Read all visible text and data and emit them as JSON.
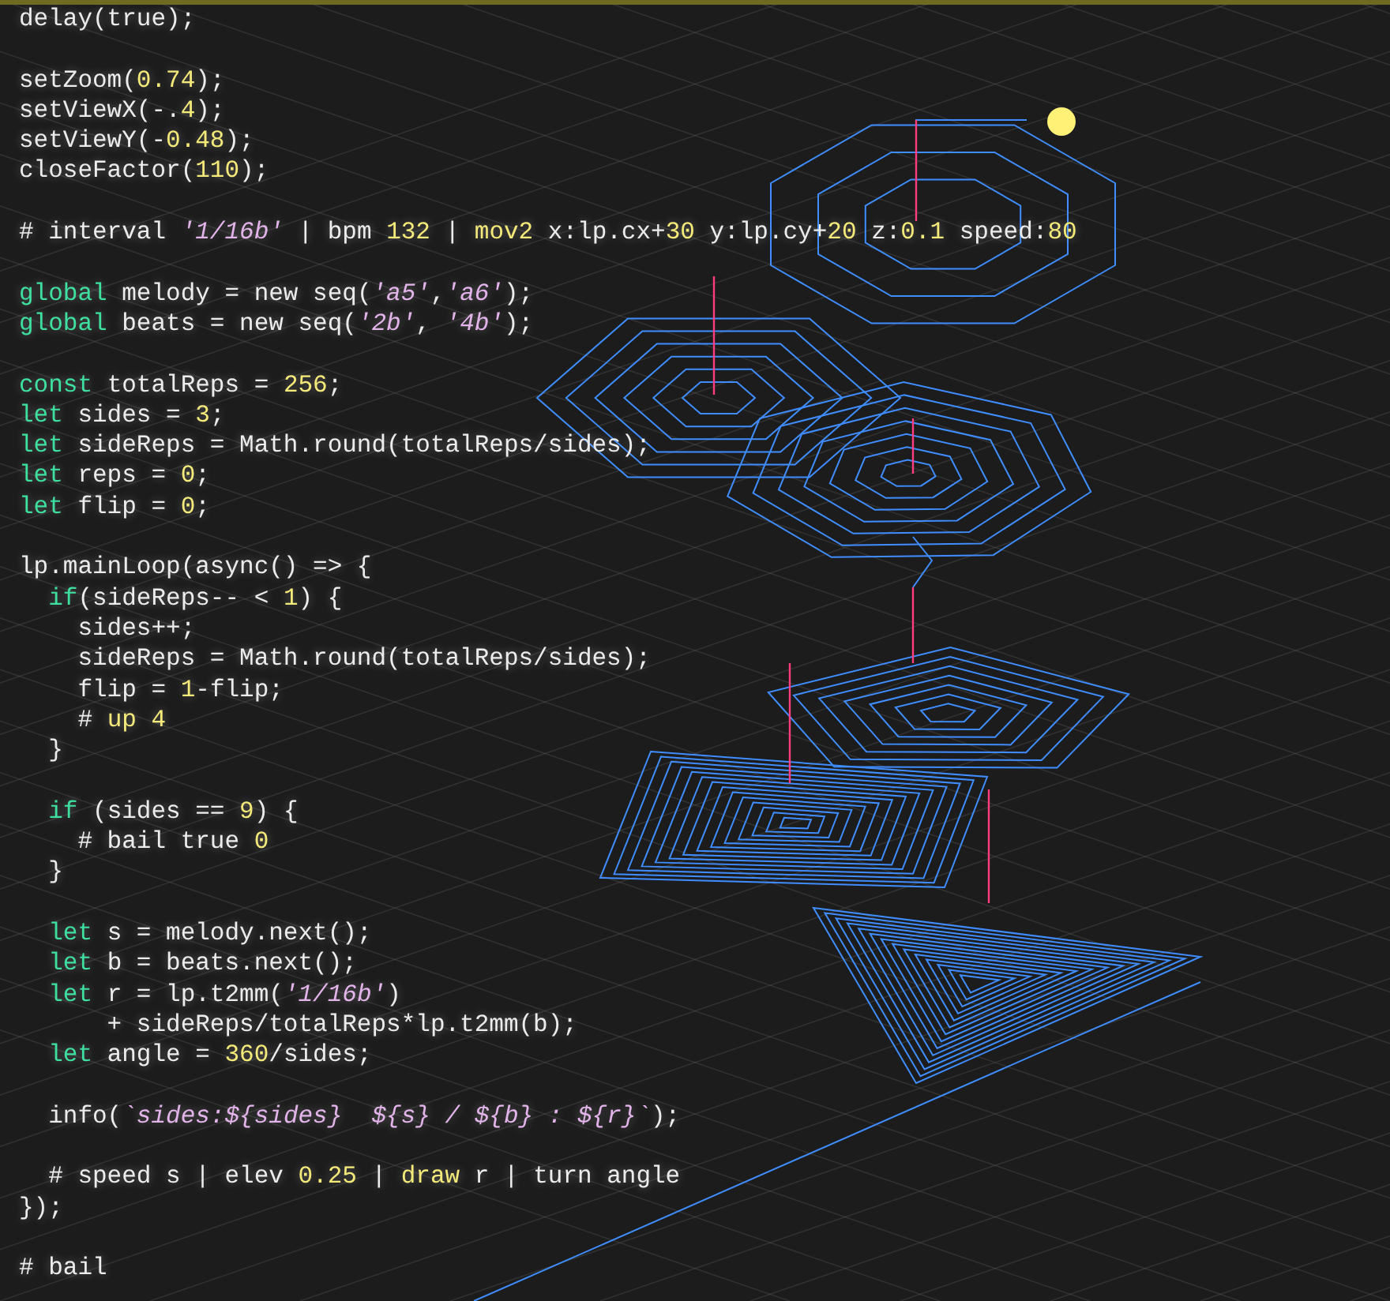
{
  "editor": {
    "lines": [
      {
        "kind": "code",
        "tokens": [
          {
            "kind": "plain",
            "text": "delay(true);"
          }
        ]
      },
      {
        "kind": "blank"
      },
      {
        "kind": "code",
        "tokens": [
          {
            "kind": "plain",
            "text": "setZoom("
          },
          {
            "kind": "number",
            "text": "0.74"
          },
          {
            "kind": "plain",
            "text": ");"
          }
        ]
      },
      {
        "kind": "code",
        "tokens": [
          {
            "kind": "plain",
            "text": "setViewX(-."
          },
          {
            "kind": "number",
            "text": "4"
          },
          {
            "kind": "plain",
            "text": ");"
          }
        ]
      },
      {
        "kind": "code",
        "tokens": [
          {
            "kind": "plain",
            "text": "setViewY(-"
          },
          {
            "kind": "number",
            "text": "0.48"
          },
          {
            "kind": "plain",
            "text": ");"
          }
        ]
      },
      {
        "kind": "code",
        "tokens": [
          {
            "kind": "plain",
            "text": "closeFactor("
          },
          {
            "kind": "number",
            "text": "110"
          },
          {
            "kind": "plain",
            "text": ");"
          }
        ]
      },
      {
        "kind": "blank"
      },
      {
        "kind": "code",
        "tokens": [
          {
            "kind": "plain",
            "text": "# interval "
          },
          {
            "kind": "string",
            "text": "'1/16b'"
          },
          {
            "kind": "plain",
            "text": " | bpm "
          },
          {
            "kind": "number",
            "text": "132"
          },
          {
            "kind": "plain",
            "text": " | "
          },
          {
            "kind": "command",
            "text": "mov2"
          },
          {
            "kind": "plain",
            "text": " x:lp.cx+"
          },
          {
            "kind": "number",
            "text": "30"
          },
          {
            "kind": "plain",
            "text": " y:lp.cy+"
          },
          {
            "kind": "number",
            "text": "20"
          },
          {
            "kind": "plain",
            "text": " z:"
          },
          {
            "kind": "number",
            "text": "0.1"
          },
          {
            "kind": "plain",
            "text": " speed:"
          },
          {
            "kind": "number",
            "text": "80"
          }
        ]
      },
      {
        "kind": "blank"
      },
      {
        "kind": "code",
        "tokens": [
          {
            "kind": "keyword",
            "text": "global"
          },
          {
            "kind": "plain",
            "text": " melody = new seq("
          },
          {
            "kind": "string",
            "text": "'a5'"
          },
          {
            "kind": "plain",
            "text": ","
          },
          {
            "kind": "string",
            "text": "'a6'"
          },
          {
            "kind": "plain",
            "text": ");"
          }
        ]
      },
      {
        "kind": "code",
        "tokens": [
          {
            "kind": "keyword",
            "text": "global"
          },
          {
            "kind": "plain",
            "text": " beats = new seq("
          },
          {
            "kind": "string",
            "text": "'2b'"
          },
          {
            "kind": "plain",
            "text": ", "
          },
          {
            "kind": "string",
            "text": "'4b'"
          },
          {
            "kind": "plain",
            "text": ");"
          }
        ]
      },
      {
        "kind": "blank"
      },
      {
        "kind": "code",
        "tokens": [
          {
            "kind": "keyword",
            "text": "const"
          },
          {
            "kind": "plain",
            "text": " totalReps = "
          },
          {
            "kind": "number",
            "text": "256"
          },
          {
            "kind": "plain",
            "text": ";"
          }
        ]
      },
      {
        "kind": "code",
        "tokens": [
          {
            "kind": "keyword",
            "text": "let"
          },
          {
            "kind": "plain",
            "text": " sides = "
          },
          {
            "kind": "number",
            "text": "3"
          },
          {
            "kind": "plain",
            "text": ";"
          }
        ]
      },
      {
        "kind": "code",
        "tokens": [
          {
            "kind": "keyword",
            "text": "let"
          },
          {
            "kind": "plain",
            "text": " sideReps = Math.round(totalReps/sides);"
          }
        ]
      },
      {
        "kind": "code",
        "tokens": [
          {
            "kind": "keyword",
            "text": "let"
          },
          {
            "kind": "plain",
            "text": " reps = "
          },
          {
            "kind": "number",
            "text": "0"
          },
          {
            "kind": "plain",
            "text": ";"
          }
        ]
      },
      {
        "kind": "code",
        "tokens": [
          {
            "kind": "keyword",
            "text": "let"
          },
          {
            "kind": "plain",
            "text": " flip = "
          },
          {
            "kind": "number",
            "text": "0"
          },
          {
            "kind": "plain",
            "text": ";"
          }
        ]
      },
      {
        "kind": "blank"
      },
      {
        "kind": "code",
        "tokens": [
          {
            "kind": "plain",
            "text": "lp.mainLoop(async() => {"
          }
        ]
      },
      {
        "kind": "code",
        "tokens": [
          {
            "kind": "keyword",
            "text": "  if"
          },
          {
            "kind": "plain",
            "text": "(sideReps-- < "
          },
          {
            "kind": "number",
            "text": "1"
          },
          {
            "kind": "plain",
            "text": ") {"
          }
        ]
      },
      {
        "kind": "code",
        "tokens": [
          {
            "kind": "plain",
            "text": "    sides++;"
          }
        ]
      },
      {
        "kind": "code",
        "tokens": [
          {
            "kind": "plain",
            "text": "    sideReps = Math.round(totalReps/sides);"
          }
        ]
      },
      {
        "kind": "code",
        "tokens": [
          {
            "kind": "plain",
            "text": "    flip = "
          },
          {
            "kind": "number",
            "text": "1"
          },
          {
            "kind": "plain",
            "text": "-flip;"
          }
        ]
      },
      {
        "kind": "code",
        "tokens": [
          {
            "kind": "plain",
            "text": "    # "
          },
          {
            "kind": "command",
            "text": "up"
          },
          {
            "kind": "number",
            "text": " 4"
          }
        ]
      },
      {
        "kind": "code",
        "tokens": [
          {
            "kind": "plain",
            "text": "  }"
          }
        ]
      },
      {
        "kind": "blank"
      },
      {
        "kind": "code",
        "tokens": [
          {
            "kind": "keyword",
            "text": "  if"
          },
          {
            "kind": "plain",
            "text": " (sides == "
          },
          {
            "kind": "number",
            "text": "9"
          },
          {
            "kind": "plain",
            "text": ") {"
          }
        ]
      },
      {
        "kind": "code",
        "tokens": [
          {
            "kind": "plain",
            "text": "    # bail true "
          },
          {
            "kind": "number",
            "text": "0"
          }
        ]
      },
      {
        "kind": "code",
        "tokens": [
          {
            "kind": "plain",
            "text": "  }"
          }
        ]
      },
      {
        "kind": "blank"
      },
      {
        "kind": "code",
        "tokens": [
          {
            "kind": "keyword",
            "text": "  let"
          },
          {
            "kind": "plain",
            "text": " s = melody.next();"
          }
        ]
      },
      {
        "kind": "code",
        "tokens": [
          {
            "kind": "keyword",
            "text": "  let"
          },
          {
            "kind": "plain",
            "text": " b = beats.next();"
          }
        ]
      },
      {
        "kind": "code",
        "tokens": [
          {
            "kind": "keyword",
            "text": "  let"
          },
          {
            "kind": "plain",
            "text": " r = lp.t2mm("
          },
          {
            "kind": "string",
            "text": "'1/16b'"
          },
          {
            "kind": "plain",
            "text": ")"
          }
        ]
      },
      {
        "kind": "code",
        "tokens": [
          {
            "kind": "plain",
            "text": "      + sideReps/totalReps*lp.t2mm(b);"
          }
        ]
      },
      {
        "kind": "code",
        "tokens": [
          {
            "kind": "keyword",
            "text": "  let"
          },
          {
            "kind": "plain",
            "text": " angle = "
          },
          {
            "kind": "number",
            "text": "360"
          },
          {
            "kind": "plain",
            "text": "/sides;"
          }
        ]
      },
      {
        "kind": "blank"
      },
      {
        "kind": "code",
        "tokens": [
          {
            "kind": "plain",
            "text": "  info("
          },
          {
            "kind": "string",
            "text": "`sides:${sides}  ${s} / ${b} : ${r}`"
          },
          {
            "kind": "plain",
            "text": ");"
          }
        ]
      },
      {
        "kind": "blank"
      },
      {
        "kind": "code",
        "tokens": [
          {
            "kind": "plain",
            "text": "  # speed s | elev "
          },
          {
            "kind": "number",
            "text": "0.25"
          },
          {
            "kind": "plain",
            "text": " | "
          },
          {
            "kind": "command",
            "text": "draw"
          },
          {
            "kind": "plain",
            "text": " r | turn angle"
          }
        ]
      },
      {
        "kind": "code",
        "tokens": [
          {
            "kind": "plain",
            "text": "});"
          }
        ]
      },
      {
        "kind": "blank"
      },
      {
        "kind": "code",
        "tokens": [
          {
            "kind": "plain",
            "text": "# bail"
          }
        ]
      }
    ]
  }
}
